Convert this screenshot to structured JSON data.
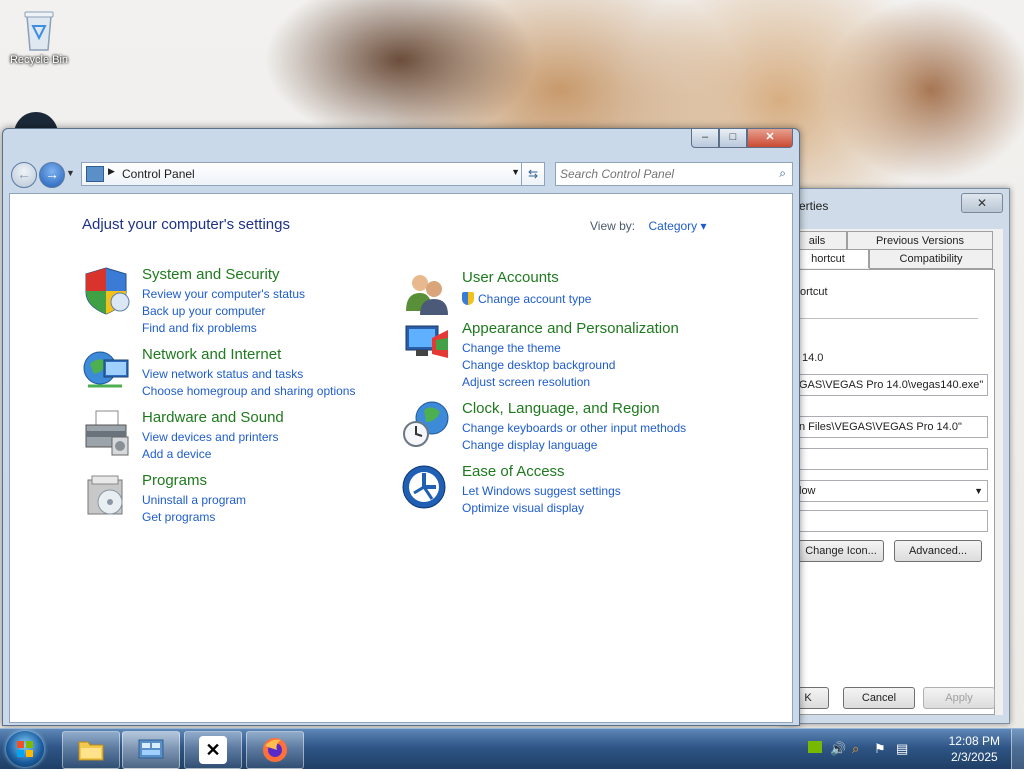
{
  "desktop": {
    "recycle_bin_label": "Recycle Bin"
  },
  "properties_window": {
    "title_fragment": "erties",
    "tabs": [
      "ails",
      "Previous Versions",
      "hortcut",
      "Compatibility"
    ],
    "shortcut_label": "ortcut",
    "version_text": "14.0",
    "target_field": "GAS\\VEGAS Pro 14.0\\vegas140.exe\"",
    "start_in_field": "n Files\\VEGAS\\VEGAS Pro 14.0\"",
    "run_select": "low",
    "change_icon_button": "Change Icon...",
    "advanced_button": "Advanced...",
    "ok_button": "K",
    "cancel_button": "Cancel",
    "apply_button": "Apply"
  },
  "window": {
    "caption_minimize": "–",
    "caption_maximize": "□",
    "caption_close": "✕",
    "breadcrumb": "Control Panel",
    "search_placeholder": "Search Control Panel",
    "heading": "Adjust your computer's settings",
    "view_by_label": "View by:",
    "view_by_value": "Category ▾"
  },
  "categories": [
    {
      "title": "System and Security",
      "icon": "shield-icon",
      "links": [
        "Review your computer's status",
        "Back up your computer",
        "Find and fix problems"
      ]
    },
    {
      "title": "Network and Internet",
      "icon": "network-icon",
      "links": [
        "View network status and tasks",
        "Choose homegroup and sharing options"
      ]
    },
    {
      "title": "Hardware and Sound",
      "icon": "printer-icon",
      "links": [
        "View devices and printers",
        "Add a device"
      ]
    },
    {
      "title": "Programs",
      "icon": "programs-icon",
      "links": [
        "Uninstall a program",
        "Get programs"
      ]
    },
    {
      "title": "User Accounts",
      "icon": "users-icon",
      "links": [
        "Change account type"
      ]
    },
    {
      "title": "Appearance and Personalization",
      "icon": "monitor-icon",
      "links": [
        "Change the theme",
        "Change desktop background",
        "Adjust screen resolution"
      ]
    },
    {
      "title": "Clock, Language, and Region",
      "icon": "globe-clock-icon",
      "links": [
        "Change keyboards or other input methods",
        "Change display language"
      ]
    },
    {
      "title": "Ease of Access",
      "icon": "ease-of-access-icon",
      "links": [
        "Let Windows suggest settings",
        "Optimize visual display"
      ]
    }
  ],
  "taskbar": {
    "items": [
      "file-explorer-icon",
      "control-panel-icon",
      "capcut-icon",
      "firefox-icon"
    ],
    "time": "12:08 PM",
    "date": "2/3/2025"
  }
}
